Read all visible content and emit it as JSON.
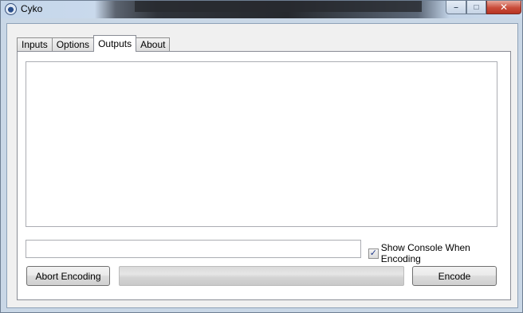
{
  "window": {
    "title": "Cyko",
    "controls": {
      "minimize": "–",
      "maximize": "□",
      "close": "✕"
    }
  },
  "tabs": [
    {
      "label": "Inputs",
      "active": false
    },
    {
      "label": "Options",
      "active": false
    },
    {
      "label": "Outputs",
      "active": true
    },
    {
      "label": "About",
      "active": false
    }
  ],
  "outputs": {
    "log_text": "",
    "path_value": "",
    "show_console": {
      "label": "Show Console When Encoding",
      "checked": true
    },
    "abort_label": "Abort Encoding",
    "encode_label": "Encode",
    "progress": 0
  },
  "colors": {
    "accent_check": "#21398a",
    "progress_fill": "#37c02b"
  }
}
